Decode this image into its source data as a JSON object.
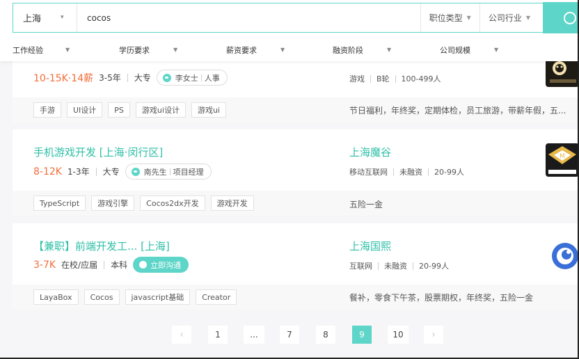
{
  "search": {
    "city": "上海",
    "query": "cocos",
    "job_type_label": "职位类型",
    "industry_label": "公司行业"
  },
  "filters": [
    "工作经验",
    "学历要求",
    "薪资要求",
    "融资阶段",
    "公司规模"
  ],
  "jobs": [
    {
      "title": "",
      "salary": "10-15K·14薪",
      "experience": "3-5年",
      "education": "大专",
      "recruiter_name": "李女士",
      "recruiter_role": "人事",
      "company_name": "",
      "industry": "游戏",
      "funding": "B轮",
      "size": "100-499人",
      "tags": [
        "手游",
        "UI设计",
        "PS",
        "游戏ui设计",
        "游戏ui"
      ],
      "benefits": "节日福利，年终奖，定期体检，员工旅游，带薪年假，五..."
    },
    {
      "title": "手机游戏开发 [上海·闵行区]",
      "salary": "8-12K",
      "experience": "1-3年",
      "education": "大专",
      "recruiter_name": "南先生",
      "recruiter_role": "项目经理",
      "company_name": "上海魔谷",
      "industry": "移动互联网",
      "funding": "未融资",
      "size": "20-99人",
      "tags": [
        "TypeScript",
        "游戏引擎",
        "Cocos2dx开发",
        "游戏开发"
      ],
      "benefits": "五险一金"
    },
    {
      "title": "【兼职】前端开发工...  [上海]",
      "salary": "3-7K",
      "experience": "在校/应届",
      "education": "本科",
      "chat_label": "立即沟通",
      "company_name": "上海国熙",
      "industry": "互联网",
      "funding": "未融资",
      "size": "20-99人",
      "tags": [
        "LayaBox",
        "Cocos",
        "javascript基础",
        "Creator"
      ],
      "benefits": "餐补，零食下午茶，股票期权，年终奖，五险一金"
    }
  ],
  "pagination": {
    "prev": "‹",
    "next": "›",
    "pages": [
      "1",
      "...",
      "7",
      "8",
      "9",
      "10"
    ],
    "current": "9"
  },
  "colors": {
    "accent": "#5dd5c8",
    "title_green": "#2ebfa7",
    "salary_orange": "#f26d38"
  }
}
